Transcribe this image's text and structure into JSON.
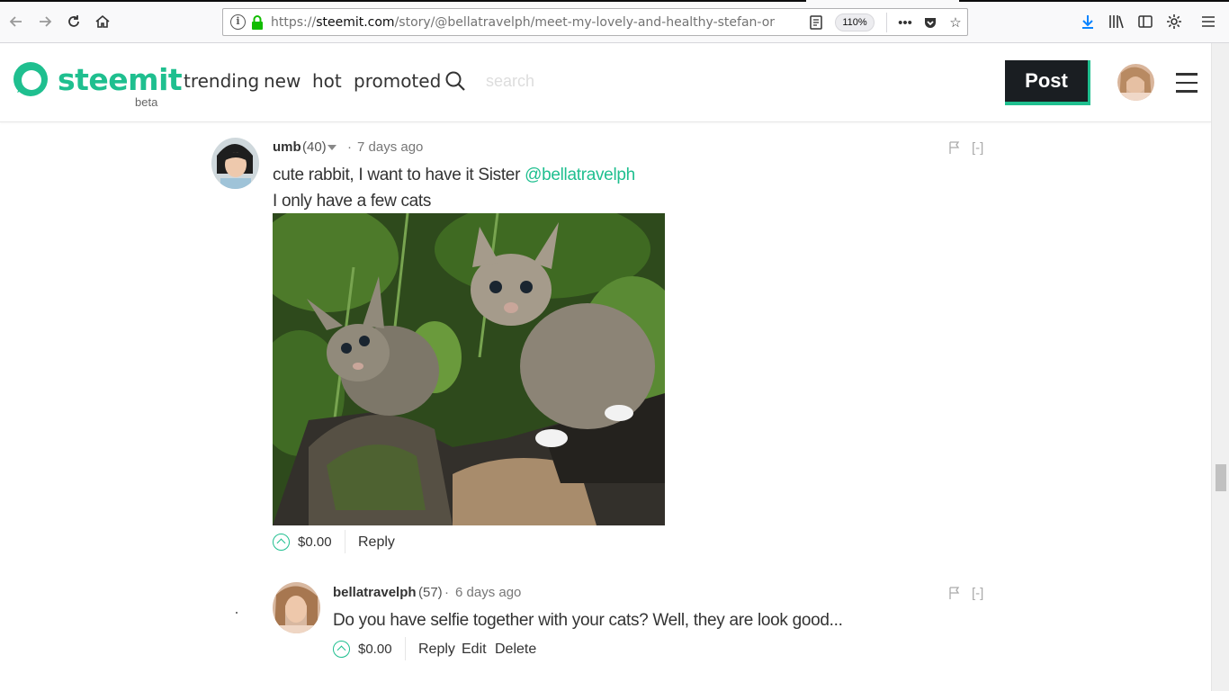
{
  "browser": {
    "url_prefix": "https://",
    "url_domain": "steemit.com",
    "url_path": "/story/@bellatravelph/meet-my-lovely-and-healthy-stefan-or-leave-a-co",
    "zoom": "110%"
  },
  "header": {
    "logo_text": "steemit",
    "logo_beta": "beta",
    "nav": [
      "trending",
      "new",
      "hot",
      "promoted"
    ],
    "search_placeholder": "search",
    "post_label": "Post",
    "accent_color": "#1fbf8f"
  },
  "comments": [
    {
      "author": "umb",
      "reputation": "(40)",
      "separator": "·",
      "time": "7 days ago",
      "collapse": "[-]",
      "line1_text": "cute rabbit, I want to have it Sister ",
      "line1_mention": "@bellatravelph",
      "line2_text": "I only have a few cats",
      "payout": "$0.00",
      "actions": [
        "Reply"
      ]
    },
    {
      "author": "bellatravelph",
      "reputation": "(57)",
      "separator": "·",
      "time": "6 days ago",
      "collapse": "[-]",
      "line1_text": "Do you have selfie together with your cats? Well, they are look good...",
      "payout": "$0.00",
      "actions": [
        "Reply",
        "Edit",
        "Delete"
      ]
    }
  ]
}
